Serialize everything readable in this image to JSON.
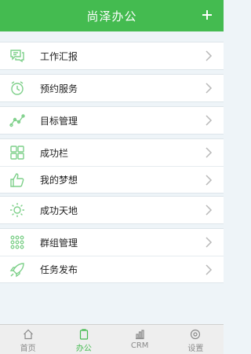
{
  "header": {
    "title": "尚泽办公",
    "add_label": "+"
  },
  "groups": [
    {
      "items": [
        {
          "label": "工作汇报",
          "icon": "chat-bubbles-icon"
        }
      ]
    },
    {
      "items": [
        {
          "label": "预约服务",
          "icon": "alarm-clock-icon"
        }
      ]
    },
    {
      "items": [
        {
          "label": "目标管理",
          "icon": "trend-line-icon"
        }
      ]
    },
    {
      "items": [
        {
          "label": "成功栏",
          "icon": "grid-icon"
        },
        {
          "label": "我的梦想",
          "icon": "thumbs-up-icon"
        }
      ]
    },
    {
      "items": [
        {
          "label": "成功天地",
          "icon": "sun-icon"
        }
      ]
    },
    {
      "items": [
        {
          "label": "群组管理",
          "icon": "dots-grid-icon"
        },
        {
          "label": "任务发布",
          "icon": "rocket-icon"
        }
      ]
    }
  ],
  "tabbar": {
    "tabs": [
      {
        "label": "首页",
        "icon": "home-icon"
      },
      {
        "label": "办公",
        "icon": "clipboard-icon",
        "active": true
      },
      {
        "label": "CRM",
        "icon": "bar-chart-icon"
      },
      {
        "label": "设置",
        "icon": "gear-icon"
      }
    ]
  },
  "colors": {
    "accent": "#44bb50",
    "icon": "#7ed08a",
    "background": "#eef4f8"
  }
}
